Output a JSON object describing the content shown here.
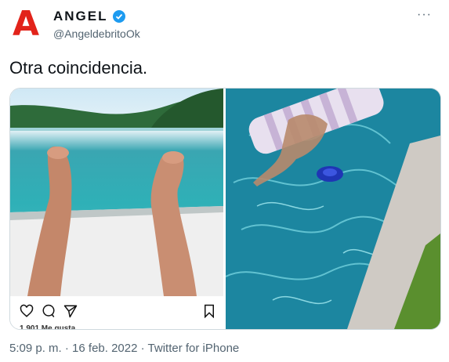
{
  "author": {
    "avatar_letter": "A",
    "name": "ANGEL",
    "handle": "@AngeldebritoOk",
    "verified": true
  },
  "more_label": "···",
  "tweet": {
    "text": "Otra coincidencia."
  },
  "media": {
    "left_photo": {
      "description_icon": "instagram-post",
      "likes_text": "1,901 Me gusta"
    },
    "right_photo": {
      "description_icon": "pool-photo"
    }
  },
  "footer": {
    "time": "5:09 p. m.",
    "separator": "·",
    "date": "16 feb. 2022",
    "source": "Twitter for iPhone"
  },
  "colors": {
    "brand_red": "#e2231a",
    "verified_blue": "#1d9bf0",
    "secondary_text": "#536471"
  }
}
